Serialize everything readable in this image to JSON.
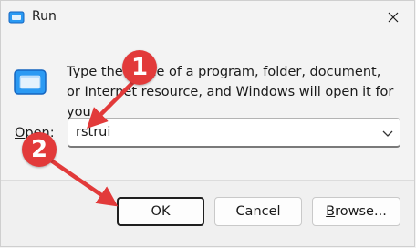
{
  "window": {
    "title": "Run",
    "app_icon": "run-icon",
    "close_icon": "close-icon"
  },
  "description": "Type the name of a program, folder, document, or Internet resource, and Windows will open it for you.",
  "open_field": {
    "label_mnemonic": "O",
    "label_rest": "pen:",
    "value": "rstrui",
    "dropdown_icon": "chevron-down-icon"
  },
  "buttons": {
    "ok": "OK",
    "cancel": "Cancel",
    "browse_mnemonic": "B",
    "browse_rest": "rowse..."
  },
  "annotations": {
    "step1": "1",
    "step2": "2",
    "color": "#e23a3a"
  }
}
